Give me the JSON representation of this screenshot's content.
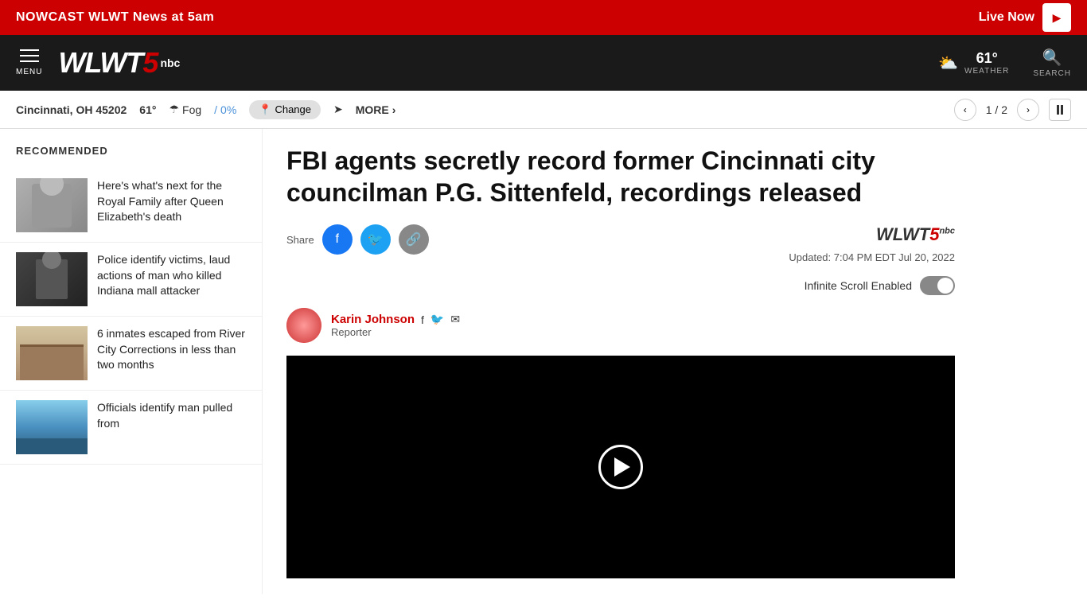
{
  "breaking_banner": {
    "nowcast_text": "NOWCAST",
    "station_text": "WLWT News at 5am",
    "live_label": "Live Now"
  },
  "header": {
    "menu_label": "MENU",
    "logo": "WLWT5",
    "logo_nbc": "nbc",
    "weather_temp": "61°",
    "weather_label": "WEATHER",
    "search_label": "SEARCH"
  },
  "location_bar": {
    "city": "Cincinnati, OH 45202",
    "temp": "61°",
    "condition": "Fog",
    "precip": "0%",
    "change_label": "Change",
    "more_label": "MORE",
    "page_current": "1",
    "page_total": "2"
  },
  "sidebar": {
    "title": "RECOMMENDED",
    "items": [
      {
        "id": 1,
        "title": "Here's what's next for the Royal Family after Queen Elizabeth's death",
        "thumb_type": "royal"
      },
      {
        "id": 2,
        "title": "Police identify victims, laud actions of man who killed Indiana mall attacker",
        "thumb_type": "mall"
      },
      {
        "id": 3,
        "title": "6 inmates escaped from River City Corrections in less than two months",
        "thumb_type": "corrections"
      },
      {
        "id": 4,
        "title": "Officials identify man pulled from",
        "thumb_type": "river"
      }
    ]
  },
  "article": {
    "title": "FBI agents secretly record former Cincinnati city councilman P.G. Sittenfeld, recordings released",
    "share_label": "Share",
    "source_logo": "WLWT5",
    "update_time": "Updated: 7:04 PM EDT Jul 20, 2022",
    "infinite_scroll_label": "Infinite Scroll Enabled",
    "author": {
      "name": "Karin Johnson",
      "role": "Reporter",
      "facebook_icon": "f",
      "twitter_icon": "🐦",
      "email_icon": "✉"
    }
  }
}
